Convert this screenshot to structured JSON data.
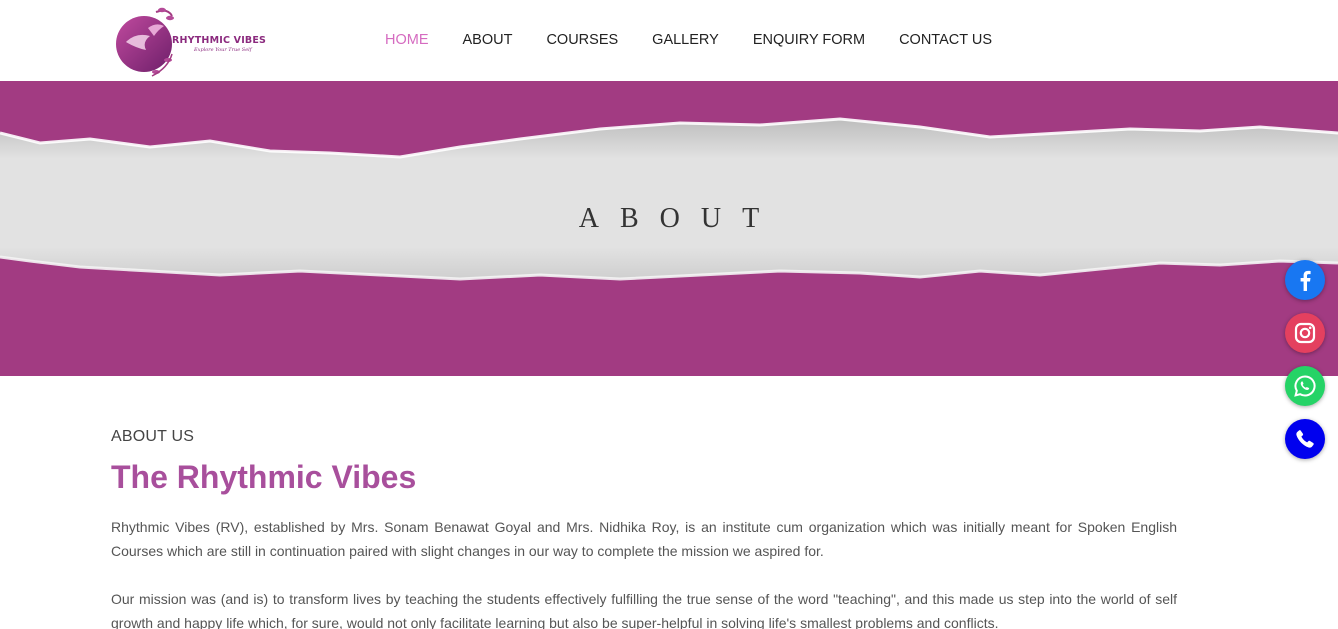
{
  "brand": {
    "name": "RHYTHMIC VIBES",
    "tagline": "Explore Your True Self",
    "color": "#a23b82"
  },
  "nav": {
    "items": [
      {
        "label": "HOME",
        "active": true
      },
      {
        "label": "ABOUT",
        "active": false
      },
      {
        "label": "COURSES",
        "active": false
      },
      {
        "label": "GALLERY",
        "active": false
      },
      {
        "label": "ENQUIRY FORM",
        "active": false
      },
      {
        "label": "CONTACT US",
        "active": false
      }
    ],
    "active_color": "#d56bc0"
  },
  "banner": {
    "title": "ABOUT",
    "background": "#a23b82"
  },
  "about": {
    "eyebrow": "ABOUT US",
    "heading": "The Rhythmic Vibes",
    "paragraphs": [
      "Rhythmic Vibes (RV), established by Mrs. Sonam Benawat Goyal and Mrs. Nidhika Roy, is an institute cum organization which was initially meant for Spoken English Courses which are still in continuation paired with slight changes in our way to complete the mission we aspired for.",
      "Our mission was (and is) to transform lives by teaching the students effectively fulfilling the true sense of the word \"teaching\", and this made us step into the world of self growth and happy life which, for sure, would not only facilitate learning but also be super-helpful in solving life's smallest problems and conflicts."
    ]
  },
  "social": [
    {
      "icon": "facebook-icon",
      "color": "#1877f2"
    },
    {
      "icon": "instagram-icon",
      "color": "#e4405f"
    },
    {
      "icon": "whatsapp-icon",
      "color": "#25d366"
    },
    {
      "icon": "phone-icon",
      "color": "#0000ee"
    }
  ]
}
